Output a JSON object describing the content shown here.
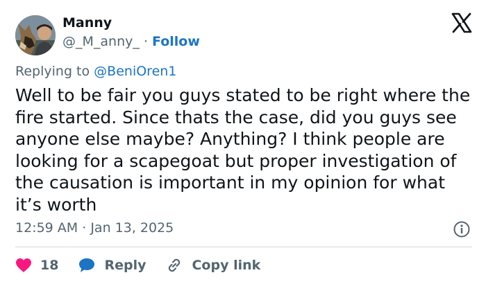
{
  "user": {
    "name": "Manny",
    "handle": "@_M_anny_",
    "separator": "·",
    "follow_label": "Follow"
  },
  "reply": {
    "prefix": "Replying to",
    "to": "@BeniOren1"
  },
  "tweet": {
    "text": "Well to be fair you guys stated to be right where the fire started. Since thats the case, did you guys see anyone else maybe? Anything? I think people are looking for a scapegoat but proper investigation of the causation is important in my opinion for what it’s worth",
    "time": "12:59 AM",
    "date_separator": "·",
    "date": "Jan 13, 2025"
  },
  "actions": {
    "likes": "18",
    "reply_label": "Reply",
    "copy_label": "Copy link"
  },
  "icons": {
    "logo": "x-logo-icon",
    "info": "info-icon",
    "like": "heart-icon",
    "reply": "speech-bubble-icon",
    "copy": "link-icon"
  },
  "colors": {
    "accent": "#1d74c5",
    "like": "#f91880",
    "muted": "#536471",
    "text": "#0f1419"
  }
}
